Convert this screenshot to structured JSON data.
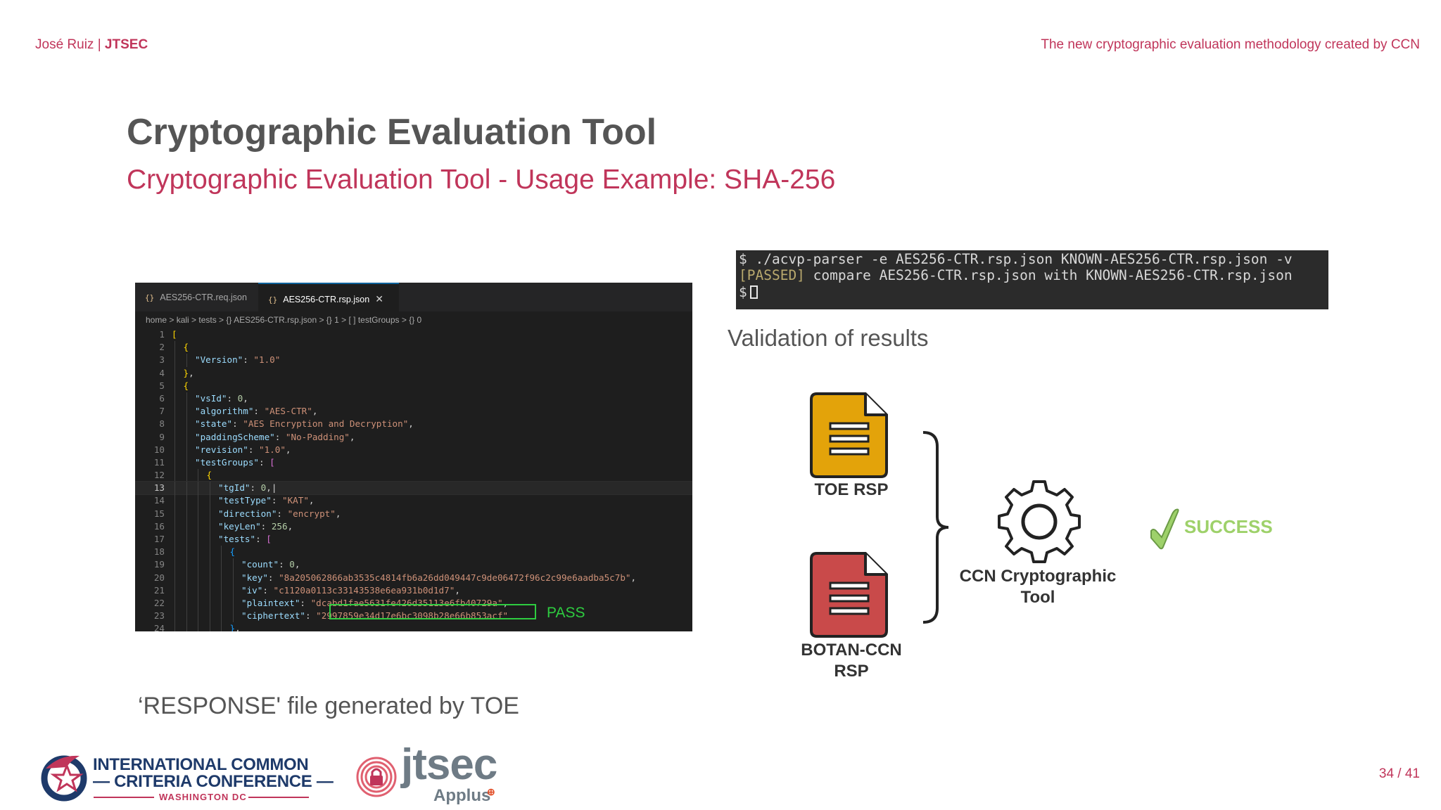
{
  "header": {
    "author": "José Ruiz | ",
    "org": "JTSEC",
    "talk_title": "The new cryptographic evaluation methodology created by CCN"
  },
  "slide": {
    "title": "Cryptographic Evaluation Tool",
    "subtitle": "Cryptographic Evaluation Tool - Usage Example: SHA-256",
    "validation_caption": "Validation of results",
    "response_caption": "‘RESPONSE' file generated by TOE"
  },
  "editor": {
    "tabs": [
      {
        "icon": "{}",
        "label": "AES256-CTR.req.json"
      },
      {
        "icon": "{}",
        "label": "AES256-CTR.rsp.json",
        "close": "✕"
      }
    ],
    "breadcrumb": "home > kali > tests > {} AES256-CTR.rsp.json > {} 1 > [ ] testGroups > {} 0",
    "current_line": 13,
    "lines": [
      {
        "n": "1",
        "indent": 0,
        "html": "<span class='p'>[</span>"
      },
      {
        "n": "2",
        "indent": 1,
        "html": "<span class='p'>{</span>"
      },
      {
        "n": "3",
        "indent": 2,
        "html": "<span class='k'>\"Version\"</span>: <span class='s'>\"1.0\"</span>"
      },
      {
        "n": "4",
        "indent": 1,
        "html": "<span class='p'>}</span>,"
      },
      {
        "n": "5",
        "indent": 1,
        "html": "<span class='p'>{</span>"
      },
      {
        "n": "6",
        "indent": 2,
        "html": "<span class='k'>\"vsId\"</span>: <span class='n'>0</span>,"
      },
      {
        "n": "7",
        "indent": 2,
        "html": "<span class='k'>\"algorithm\"</span>: <span class='s'>\"AES-CTR\"</span>,"
      },
      {
        "n": "8",
        "indent": 2,
        "html": "<span class='k'>\"state\"</span>: <span class='s'>\"AES Encryption and Decryption\"</span>,"
      },
      {
        "n": "9",
        "indent": 2,
        "html": "<span class='k'>\"paddingScheme\"</span>: <span class='s'>\"No-Padding\"</span>,"
      },
      {
        "n": "10",
        "indent": 2,
        "html": "<span class='k'>\"revision\"</span>: <span class='s'>\"1.0\"</span>,"
      },
      {
        "n": "11",
        "indent": 2,
        "html": "<span class='k'>\"testGroups\"</span>: <span class='p' style='color:#da70d6'>[</span>"
      },
      {
        "n": "12",
        "indent": 3,
        "html": "<span class='p'>{</span>"
      },
      {
        "n": "13",
        "indent": 4,
        "html": "<span class='k'>\"tgId\"</span>: <span class='n'>0</span>,|"
      },
      {
        "n": "14",
        "indent": 4,
        "html": "<span class='k'>\"testType\"</span>: <span class='s'>\"KAT\"</span>,"
      },
      {
        "n": "15",
        "indent": 4,
        "html": "<span class='k'>\"direction\"</span>: <span class='s'>\"encrypt\"</span>,"
      },
      {
        "n": "16",
        "indent": 4,
        "html": "<span class='k'>\"keyLen\"</span>: <span class='n'>256</span>,"
      },
      {
        "n": "17",
        "indent": 4,
        "html": "<span class='k'>\"tests\"</span>: <span class='p' style='color:#da70d6'>[</span>"
      },
      {
        "n": "18",
        "indent": 5,
        "html": "<span class='p' style='color:#179fff'>{</span>"
      },
      {
        "n": "19",
        "indent": 6,
        "html": "<span class='k'>\"count\"</span>: <span class='n'>0</span>,"
      },
      {
        "n": "20",
        "indent": 6,
        "html": "<span class='k'>\"key\"</span>: <span class='s'>\"8a205062866ab3535c4814fb6a26dd049447c9de06472f96c2c99e6aadba5c7b\"</span>,"
      },
      {
        "n": "21",
        "indent": 6,
        "html": "<span class='k'>\"iv\"</span>: <span class='s'>\"c1120a0113c33143538e6ea931b0d1d7\"</span>,"
      },
      {
        "n": "22",
        "indent": 6,
        "html": "<span class='k'>\"plaintext\"</span>: <span class='s'>\"dcabd1fae5631fe426d35113e6fb40729a\"</span>,"
      },
      {
        "n": "23",
        "indent": 6,
        "html": "<span class='k'>\"ciphertext\"</span>: <span class='s'>\"2997859e34d17e6bc3098b28e66b853acf\"</span>"
      },
      {
        "n": "24",
        "indent": 5,
        "html": "<span class='p' style='color:#179fff'>}</span>,"
      }
    ],
    "pass_label": "PASS"
  },
  "terminal": {
    "line1": "$ ./acvp-parser -e AES256-CTR.rsp.json KNOWN-AES256-CTR.rsp.json -v",
    "passed_tag": "[PASSED]",
    "line2_rest": " compare AES256-CTR.rsp.json with KNOWN-AES256-CTR.rsp.json",
    "prompt": "$"
  },
  "diagram": {
    "toe_label": "TOE RSP",
    "botan_line1": "BOTAN-CCN",
    "botan_line2": "RSP",
    "tool_line1": "CCN Cryptographic",
    "tool_line2": "Tool",
    "success": "SUCCESS",
    "colors": {
      "toe": "#e3a30a",
      "botan": "#c94a4a",
      "success": "#9ed16a"
    }
  },
  "footer": {
    "iccc_line1": "INTERNATIONAL COMMON",
    "iccc_line2": "— CRITERIA CONFERENCE —",
    "iccc_line3": "WASHINGTON DC",
    "jtsec": "jtsec",
    "applus": "Applus",
    "applus_mark": "⊕",
    "page": "34 / 41"
  }
}
